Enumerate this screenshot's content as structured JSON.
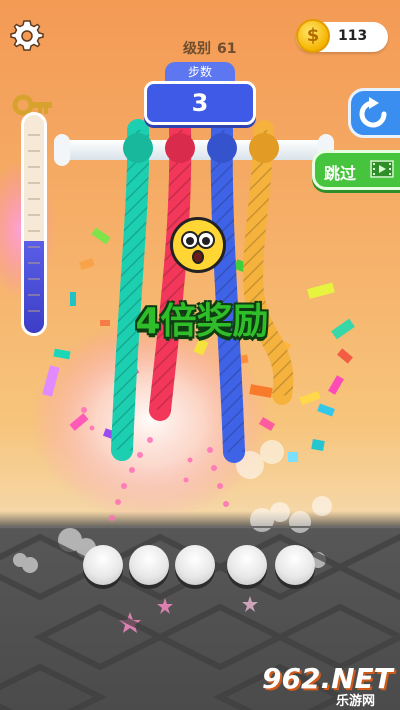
{
  "hud": {
    "level_label": "级别",
    "level_number": "61",
    "coins": "113",
    "coin_symbol": "$",
    "steps_label": "步数",
    "steps_value": "3"
  },
  "buttons": {
    "skip_label": "跳过",
    "settings_icon": "gear-icon",
    "undo_icon": "undo-arrow-icon",
    "skip_icon": "video-film-icon"
  },
  "progress": {
    "key_icon": "key-icon",
    "fill_fraction": 0.42
  },
  "celebration": {
    "bonus_text": "4倍奖励",
    "emoji": "surprised-face"
  },
  "ropes": [
    {
      "color": "#1ccfb0",
      "name": "teal-rope"
    },
    {
      "color": "#f2375a",
      "name": "red-rope"
    },
    {
      "color": "#3f63e6",
      "name": "blue-rope"
    },
    {
      "color": "#f5b23d",
      "name": "orange-rope"
    }
  ],
  "pegs_count": 5,
  "watermark": {
    "main": "962.NET",
    "sub": "乐游网"
  },
  "colors": {
    "accent_blue": "#3f5ae6",
    "accent_green": "#46c43d",
    "bonus_green": "#2fbd2a"
  }
}
